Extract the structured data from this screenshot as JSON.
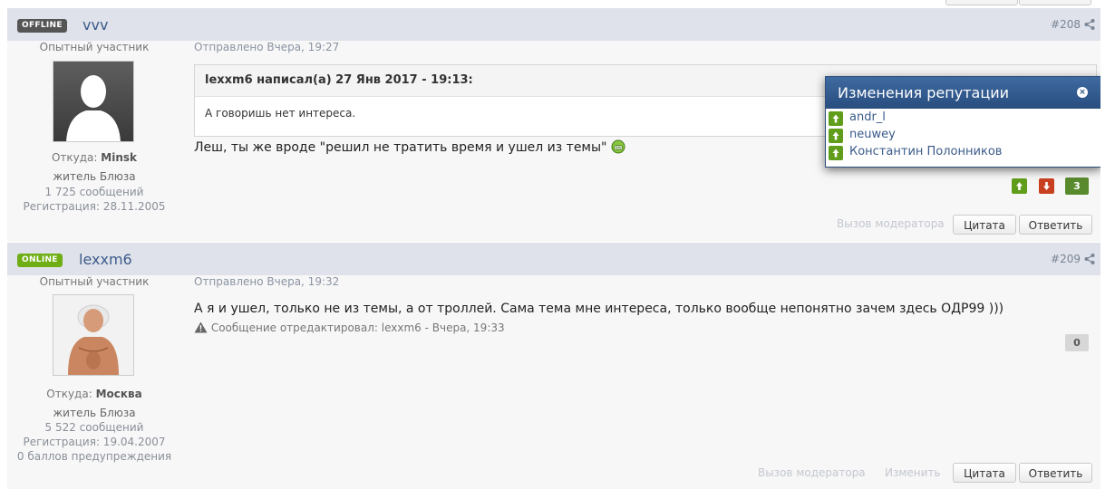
{
  "posts": [
    {
      "status": "OFFLINE",
      "username": "vvv",
      "number": "#208",
      "rank": "Опытный участник",
      "from_label": "Откуда:",
      "from_value": "Minsk",
      "title": "житель Блюза",
      "messages": "1 725 сообщений",
      "registered": "Регистрация: 28.11.2005",
      "posted": "Отправлено Вчера, 19:27",
      "quote_head": "lexxm6 написал(а) 27 Янв 2017 - 19:13:",
      "quote_body": "А говоришь нет интереса.",
      "text": "Леш, ты же вроде \"решил не тратить время и ушел из темы\"",
      "rep_count": "3",
      "moderator": "Вызов модератора",
      "quote_btn": "Цитата",
      "reply_btn": "Ответить"
    },
    {
      "status": "ONLINE",
      "username": "lexxm6",
      "number": "#209",
      "rank": "Опытный участник",
      "from_label": "Откуда:",
      "from_value": "Москва",
      "title": "житель Блюза",
      "messages": "5 522 сообщений",
      "registered": "Регистрация: 19.04.2007",
      "warnings": "0 баллов предупреждения",
      "posted": "Отправлено Вчера, 19:32",
      "text": "А я и ушел, только не из темы, а от троллей. Сама тема мне интереса, только вообще непонятно зачем здесь ОДР99 )))",
      "edited": "Сообщение отредактировал: lexxm6 - Вчера, 19:33",
      "rep_count": "0",
      "moderator": "Вызов модератора",
      "edit": "Изменить",
      "quote_btn": "Цитата",
      "reply_btn": "Ответить"
    }
  ],
  "popup": {
    "title": "Изменения репутации",
    "users": [
      "andr_l",
      "neuwey",
      "Константин Полонников"
    ]
  },
  "colors": {
    "header_bg": "#dfe2ea",
    "link": "#3b5b8a",
    "online": "#6fae15",
    "offline": "#555555",
    "rep_up": "#5f9d1a",
    "rep_down": "#c8401f"
  }
}
